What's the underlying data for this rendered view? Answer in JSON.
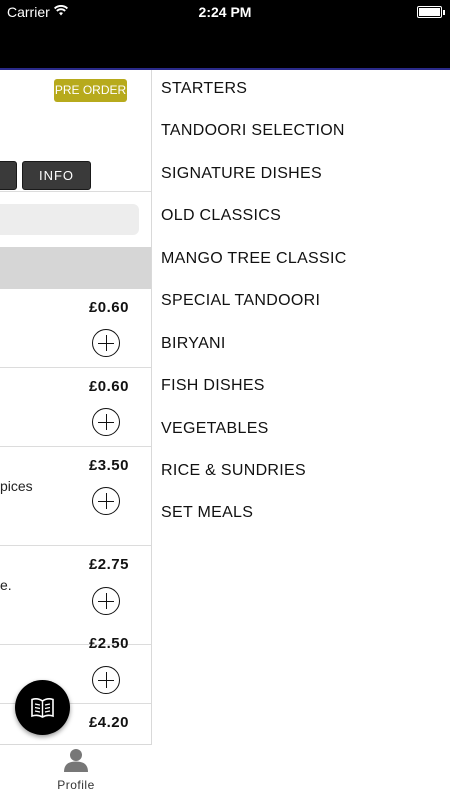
{
  "status_bar": {
    "carrier": "Carrier",
    "time": "2:24 PM"
  },
  "main": {
    "preorder_label": "PRE ORDER",
    "info_label": "INFO",
    "items": [
      {
        "price": "£0.60",
        "desc": ""
      },
      {
        "price": "£0.60",
        "desc": ""
      },
      {
        "price": "£3.50",
        "desc": "pices"
      },
      {
        "price": "£2.75",
        "desc": "e."
      },
      {
        "price": "£2.50",
        "desc": ""
      },
      {
        "price": "£4.20",
        "desc": ""
      }
    ]
  },
  "tabbar": {
    "profile_label": "Profile"
  },
  "side_menu": {
    "items": [
      "STARTERS",
      "TANDOORI SELECTION",
      "SIGNATURE DISHES",
      "OLD CLASSICS",
      "MANGO TREE CLASSIC",
      "SPECIAL TANDOORI",
      "BIRYANI",
      "FISH DISHES",
      "VEGETABLES",
      "RICE & SUNDRIES",
      "SET MEALS"
    ]
  },
  "colors": {
    "preorder": "#b7aa1c",
    "header": "#000000",
    "category_bar": "#d6d6d6"
  },
  "icons": {
    "wifi": "wifi-icon",
    "battery": "battery-icon",
    "add": "plus-circle-icon",
    "profile": "profile-icon",
    "menu_fab": "book-icon"
  }
}
